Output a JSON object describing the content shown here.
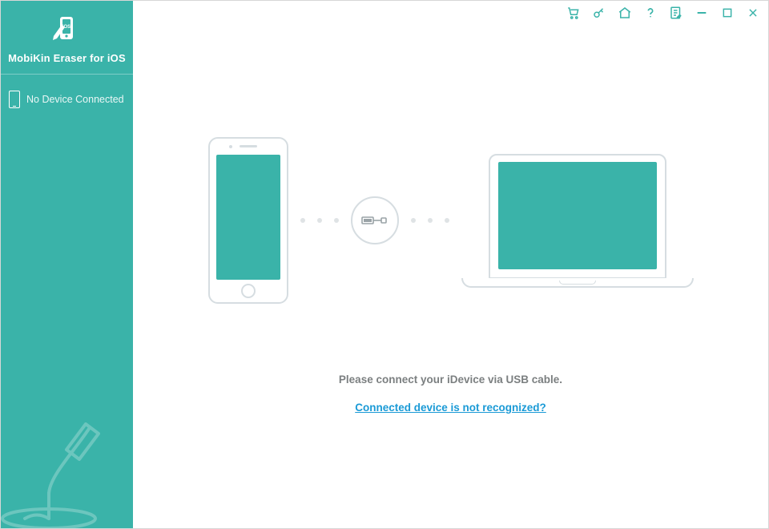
{
  "brand": {
    "title": "MobiKin Eraser for iOS"
  },
  "sidebar": {
    "device_status": "No Device Connected"
  },
  "titlebar": {
    "icons": {
      "cart": "cart-icon",
      "key": "key-icon",
      "home": "home-icon",
      "help": "help-icon",
      "feedback": "feedback-icon",
      "minimize": "minimize-icon",
      "maximize": "maximize-icon",
      "close": "close-icon"
    }
  },
  "content": {
    "instruction": "Please connect your iDevice via USB cable.",
    "help_link": "Connected device is not recognized?"
  },
  "colors": {
    "accent": "#3ab3a9",
    "link": "#1a9ad6",
    "muted_line": "#d6dde1",
    "text_muted": "#7b7f80"
  }
}
